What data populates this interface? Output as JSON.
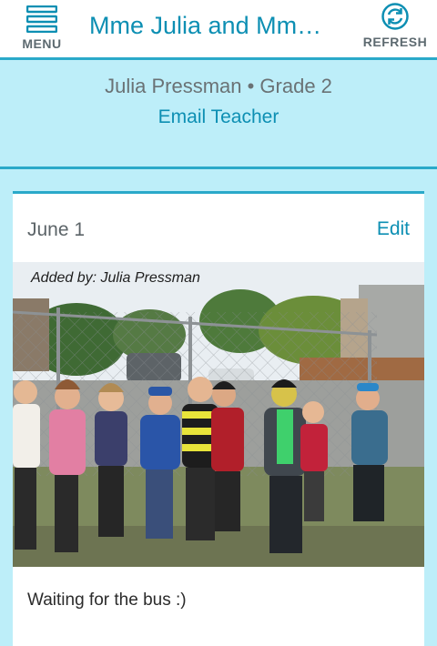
{
  "header": {
    "menu_label": "MENU",
    "title": "Mme Julia and Mm…",
    "refresh_label": "REFRESH",
    "menu_icon": "hamburger-icon",
    "refresh_icon": "refresh-icon"
  },
  "class_info": {
    "teacher_line": "Julia Pressman • Grade 2",
    "email_label": "Email Teacher"
  },
  "post": {
    "date": "June 1",
    "edit_label": "Edit",
    "added_by": "Added by: Julia Pressman",
    "caption": "Waiting for the bus :)"
  },
  "colors": {
    "accent": "#0d8fb3",
    "border": "#2aa9c9",
    "background": "#bdeef9"
  }
}
